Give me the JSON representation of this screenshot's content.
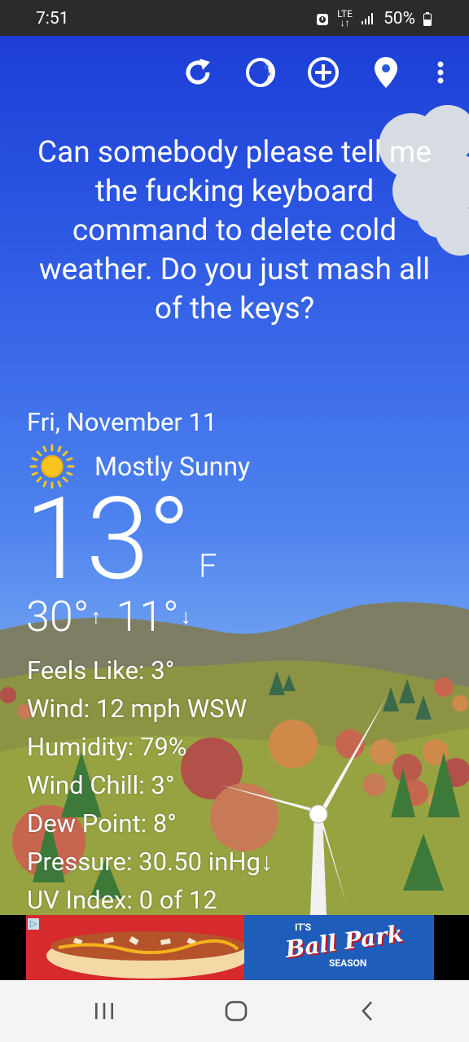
{
  "status_bar": {
    "time": "7:51",
    "network_top": "LTE",
    "network_bottom": "↓↑",
    "battery": "50%",
    "icons": [
      "alarm-icon",
      "signal-icon",
      "battery-icon"
    ]
  },
  "toolbar": {
    "icons": [
      "refresh-icon",
      "theme-icon",
      "add-location-icon",
      "location-pin-icon",
      "more-vert-icon"
    ]
  },
  "quote": "Can somebody please tell me the fucking keyboard command to delete cold weather. Do you just mash all of the keys?",
  "weather": {
    "date": "Fri, November 11",
    "condition": "Mostly Sunny",
    "condition_icon": "sun-icon",
    "temperature": "13°",
    "unit": "F",
    "high": "30°",
    "low": "11°",
    "high_arrow": "↑",
    "low_arrow": "↓",
    "details": {
      "feels_like": "Feels Like:  3°",
      "wind": "Wind:  12 mph WSW",
      "humidity": "Humidity:  79%",
      "wind_chill": "Wind Chill:  3°",
      "dew_point": "Dew Point:  8°",
      "pressure": "Pressure:  30.50 inHg↓",
      "uv_index": "UV Index:  0 of 12"
    }
  },
  "ad": {
    "tagline_top": "IT'S",
    "brand": "Ball Park",
    "tagline_bottom": "SEASON",
    "adchoices_icon": "adchoices-icon"
  },
  "nav_bar": {
    "icons": [
      "recents-icon",
      "home-icon",
      "back-icon"
    ]
  },
  "colors": {
    "sky_top": "#1c3ed6",
    "sky_bottom": "#9fc3f5",
    "hill": "#8a9a3c",
    "ad_red": "#d8242a",
    "ad_blue": "#1f5dbb"
  }
}
